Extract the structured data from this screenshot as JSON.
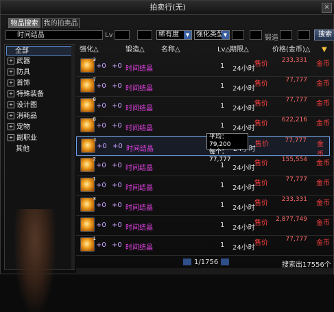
{
  "window": {
    "title": "拍卖行(无)",
    "close_label": "×"
  },
  "tabs": [
    {
      "label": "物品搜索"
    },
    {
      "label": "我的拍卖品"
    }
  ],
  "search": {
    "value": "时间结晶",
    "icon": "search-icon",
    "filters": {
      "level_label": "Lv",
      "rarity": "稀有度",
      "enhance": "强化类型",
      "reinforce_label": "锻造",
      "search_button": "搜索"
    }
  },
  "categories": [
    {
      "label": "全部",
      "expandable": false,
      "selected": true
    },
    {
      "label": "武器",
      "expandable": true
    },
    {
      "label": "防具",
      "expandable": true
    },
    {
      "label": "首饰",
      "expandable": true
    },
    {
      "label": "特殊装备",
      "expandable": true
    },
    {
      "label": "设计图",
      "expandable": true
    },
    {
      "label": "消耗品",
      "expandable": true
    },
    {
      "label": "宠物",
      "expandable": true
    },
    {
      "label": "副职业",
      "expandable": true
    },
    {
      "label": "其他",
      "expandable": false
    }
  ],
  "columns": {
    "enhance": "强化△",
    "reinforce": "锻造△",
    "name": "名称△",
    "level": "Lv△",
    "period": "期限△",
    "price": "价格(金币)△"
  },
  "rows": [
    {
      "qty": "3",
      "enhance": "+0",
      "reinforce": "+0",
      "name": "时间结晶",
      "level": "1",
      "period": "24小时",
      "sell": "售价",
      "price_top": "233,331",
      "price_bottom": "",
      "currency": "金币"
    },
    {
      "qty": "7",
      "enhance": "+0",
      "reinforce": "+0",
      "name": "时间结晶",
      "level": "1",
      "period": "24小时",
      "sell": "售价",
      "price_top": "77,777",
      "price_bottom": "",
      "currency": "金币"
    },
    {
      "qty": "8",
      "enhance": "+0",
      "reinforce": "+0",
      "name": "时间结晶",
      "level": "1",
      "period": "24小时",
      "sell": "售价",
      "price_top": "77,777",
      "price_bottom": "",
      "currency": "金币"
    },
    {
      "qty": "8",
      "enhance": "+0",
      "reinforce": "+0",
      "name": "时间结晶",
      "level": "1",
      "period": "24小时",
      "sell": "售价",
      "price_top": "622,216",
      "price_bottom": "",
      "currency": "金币"
    },
    {
      "qty": "1",
      "enhance": "+0",
      "reinforce": "+0",
      "name": "时间结晶",
      "level": "1",
      "period": "24小时",
      "sell": "售价",
      "price_top": "77,777",
      "price_bottom": "",
      "currency": "金币"
    },
    {
      "qty": "2",
      "enhance": "+0",
      "reinforce": "+0",
      "name": "时间结晶",
      "level": "1",
      "period": "24小时",
      "sell": "售价",
      "price_top": "155,554",
      "price_bottom": "",
      "currency": "金币"
    },
    {
      "qty": "1",
      "enhance": "+0",
      "reinforce": "+0",
      "name": "时间结晶",
      "level": "1",
      "period": "24小时",
      "sell": "售价",
      "price_top": "77,777",
      "price_bottom": "",
      "currency": "金币"
    },
    {
      "qty": "3",
      "enhance": "+0",
      "reinforce": "+0",
      "name": "时间结晶",
      "level": "1",
      "period": "24小时",
      "sell": "售价",
      "price_top": "233,331",
      "price_bottom": "",
      "currency": "金币"
    },
    {
      "qty": "",
      "enhance": "+0",
      "reinforce": "+0",
      "name": "时间结晶",
      "level": "1",
      "period": "24小时",
      "sell": "售价",
      "price_top": "2,877,749",
      "price_bottom": "",
      "currency": "金币"
    },
    {
      "qty": "1",
      "enhance": "+0",
      "reinforce": "+0",
      "name": "时间结晶",
      "level": "1",
      "period": "24小时",
      "sell": "售价",
      "price_top": "77,777",
      "price_bottom": "",
      "currency": "金币"
    }
  ],
  "tooltip": {
    "avg": "平均：79,200",
    "each": "每个：77,777"
  },
  "pager": {
    "text": "1/1756"
  },
  "footer": {
    "count": "搜索出17556个"
  },
  "colors": {
    "accent": "#5a8acc",
    "sell_red": "#ff4040",
    "name_magenta": "#e040e0"
  }
}
